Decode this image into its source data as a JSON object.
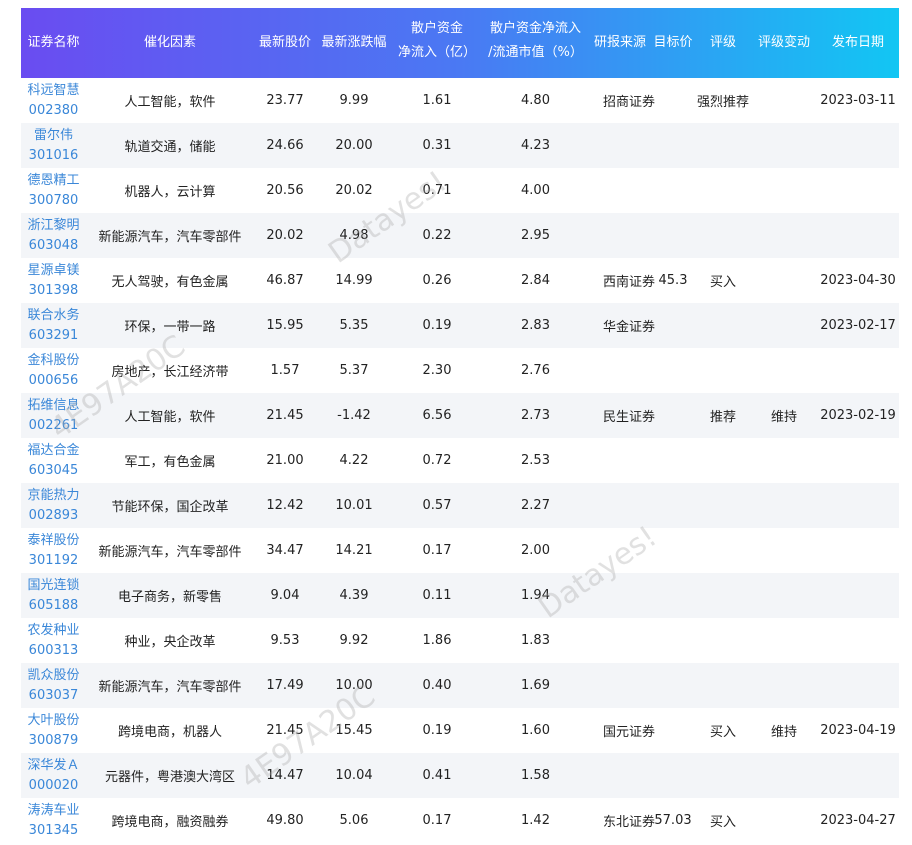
{
  "headers": {
    "name": "证券名称",
    "catalyst": "催化因素",
    "price": "最新股价",
    "change": "最新涨跌幅",
    "flow_l1": "散户资金",
    "flow_l2": "净流入（亿）",
    "ratio_l1": "散户资金净流入",
    "ratio_l2": "/流通市值（%）",
    "source": "研报来源",
    "target": "目标价",
    "rating": "评级",
    "rating_change": "评级变动",
    "date": "发布日期"
  },
  "rows": [
    {
      "name": "科远智慧",
      "code": "002380",
      "catalyst": "人工智能，软件",
      "price": "23.77",
      "change": "9.99",
      "flow": "1.61",
      "ratio": "4.80",
      "source": "招商证券",
      "target": "",
      "rating": "强烈推荐",
      "rating_change": "",
      "date": "2023-03-11"
    },
    {
      "name": "雷尔伟",
      "code": "301016",
      "catalyst": "轨道交通，储能",
      "price": "24.66",
      "change": "20.00",
      "flow": "0.31",
      "ratio": "4.23",
      "source": "",
      "target": "",
      "rating": "",
      "rating_change": "",
      "date": ""
    },
    {
      "name": "德恩精工",
      "code": "300780",
      "catalyst": "机器人，云计算",
      "price": "20.56",
      "change": "20.02",
      "flow": "0.71",
      "ratio": "4.00",
      "source": "",
      "target": "",
      "rating": "",
      "rating_change": "",
      "date": ""
    },
    {
      "name": "浙江黎明",
      "code": "603048",
      "catalyst": "新能源汽车，汽车零部件",
      "price": "20.02",
      "change": "4.98",
      "flow": "0.22",
      "ratio": "2.95",
      "source": "",
      "target": "",
      "rating": "",
      "rating_change": "",
      "date": ""
    },
    {
      "name": "星源卓镁",
      "code": "301398",
      "catalyst": "无人驾驶，有色金属",
      "price": "46.87",
      "change": "14.99",
      "flow": "0.26",
      "ratio": "2.84",
      "source": "西南证券",
      "target": "45.3",
      "rating": "买入",
      "rating_change": "",
      "date": "2023-04-30"
    },
    {
      "name": "联合水务",
      "code": "603291",
      "catalyst": "环保，一带一路",
      "price": "15.95",
      "change": "5.35",
      "flow": "0.19",
      "ratio": "2.83",
      "source": "华金证券",
      "target": "",
      "rating": "",
      "rating_change": "",
      "date": "2023-02-17"
    },
    {
      "name": "金科股份",
      "code": "000656",
      "catalyst": "房地产，长江经济带",
      "price": "1.57",
      "change": "5.37",
      "flow": "2.30",
      "ratio": "2.76",
      "source": "",
      "target": "",
      "rating": "",
      "rating_change": "",
      "date": ""
    },
    {
      "name": "拓维信息",
      "code": "002261",
      "catalyst": "人工智能，软件",
      "price": "21.45",
      "change": "-1.42",
      "flow": "6.56",
      "ratio": "2.73",
      "source": "民生证券",
      "target": "",
      "rating": "推荐",
      "rating_change": "维持",
      "date": "2023-02-19"
    },
    {
      "name": "福达合金",
      "code": "603045",
      "catalyst": "军工，有色金属",
      "price": "21.00",
      "change": "4.22",
      "flow": "0.72",
      "ratio": "2.53",
      "source": "",
      "target": "",
      "rating": "",
      "rating_change": "",
      "date": ""
    },
    {
      "name": "京能热力",
      "code": "002893",
      "catalyst": "节能环保，国企改革",
      "price": "12.42",
      "change": "10.01",
      "flow": "0.57",
      "ratio": "2.27",
      "source": "",
      "target": "",
      "rating": "",
      "rating_change": "",
      "date": ""
    },
    {
      "name": "泰祥股份",
      "code": "301192",
      "catalyst": "新能源汽车，汽车零部件",
      "price": "34.47",
      "change": "14.21",
      "flow": "0.17",
      "ratio": "2.00",
      "source": "",
      "target": "",
      "rating": "",
      "rating_change": "",
      "date": ""
    },
    {
      "name": "国光连锁",
      "code": "605188",
      "catalyst": "电子商务，新零售",
      "price": "9.04",
      "change": "4.39",
      "flow": "0.11",
      "ratio": "1.94",
      "source": "",
      "target": "",
      "rating": "",
      "rating_change": "",
      "date": ""
    },
    {
      "name": "农发种业",
      "code": "600313",
      "catalyst": "种业，央企改革",
      "price": "9.53",
      "change": "9.92",
      "flow": "1.86",
      "ratio": "1.83",
      "source": "",
      "target": "",
      "rating": "",
      "rating_change": "",
      "date": ""
    },
    {
      "name": "凯众股份",
      "code": "603037",
      "catalyst": "新能源汽车，汽车零部件",
      "price": "17.49",
      "change": "10.00",
      "flow": "0.40",
      "ratio": "1.69",
      "source": "",
      "target": "",
      "rating": "",
      "rating_change": "",
      "date": ""
    },
    {
      "name": "大叶股份",
      "code": "300879",
      "catalyst": "跨境电商，机器人",
      "price": "21.45",
      "change": "15.45",
      "flow": "0.19",
      "ratio": "1.60",
      "source": "国元证券",
      "target": "",
      "rating": "买入",
      "rating_change": "维持",
      "date": "2023-04-19"
    },
    {
      "name": "深华发Ａ",
      "code": "000020",
      "catalyst": "元器件，粤港澳大湾区",
      "price": "14.47",
      "change": "10.04",
      "flow": "0.41",
      "ratio": "1.58",
      "source": "",
      "target": "",
      "rating": "",
      "rating_change": "",
      "date": ""
    },
    {
      "name": "涛涛车业",
      "code": "301345",
      "catalyst": "跨境电商，融资融券",
      "price": "49.80",
      "change": "5.06",
      "flow": "0.17",
      "ratio": "1.42",
      "source": "东北证券",
      "target": "57.03",
      "rating": "买入",
      "rating_change": "",
      "date": "2023-04-27"
    }
  ],
  "watermarks": [
    "Datayes!",
    "4E97A20C",
    "Datayes!",
    "4E97A20C"
  ]
}
